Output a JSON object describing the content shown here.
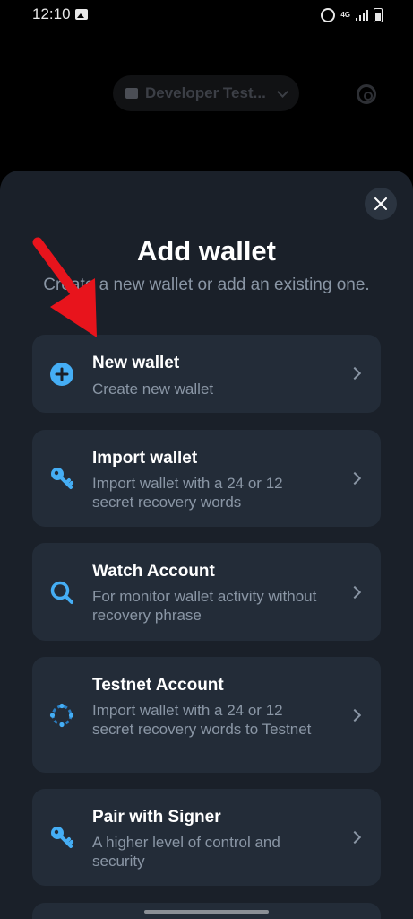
{
  "status_bar": {
    "time": "12:10",
    "network": "4G"
  },
  "background": {
    "environment_label": "Developer Test..."
  },
  "sheet": {
    "title": "Add wallet",
    "subtitle": "Create a new wallet or add an existing one.",
    "options": [
      {
        "title": "New wallet",
        "description": "Create new wallet",
        "icon": "plus-circle-icon"
      },
      {
        "title": "Import wallet",
        "description": "Import wallet with a 24 or 12 secret recovery words",
        "icon": "key-icon"
      },
      {
        "title": "Watch Account",
        "description": "For monitor wallet activity without recovery phrase",
        "icon": "magnifier-icon"
      },
      {
        "title": "Testnet Account",
        "description": "Import wallet with a 24 or 12 secret recovery words to Testnet",
        "icon": "testnet-ring-icon"
      },
      {
        "title": "Pair with Signer",
        "description": "A higher level of control and security",
        "icon": "key-icon"
      }
    ]
  },
  "colors": {
    "sheet_bg": "#1a2029",
    "card_bg": "#232c38",
    "accent_blue": "#45aef5",
    "secondary_text": "#8a96a5",
    "annotation_arrow": "#e8141c"
  }
}
